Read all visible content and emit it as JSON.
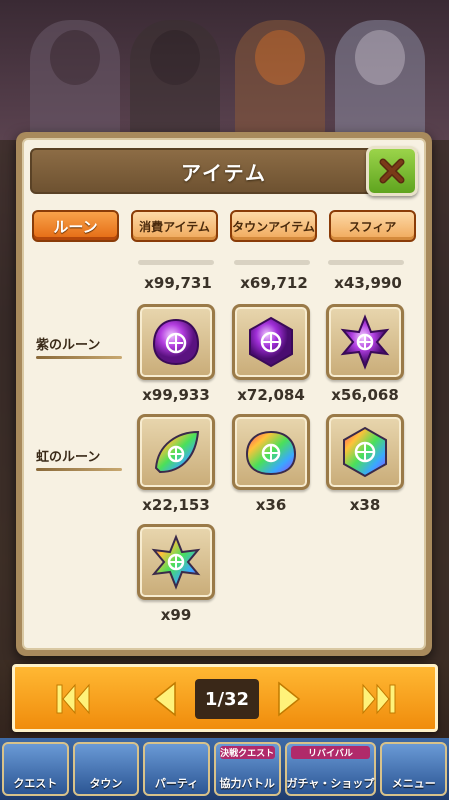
{
  "title": "アイテム",
  "tabs": [
    {
      "label": "ルーン",
      "active": true
    },
    {
      "label": "消費アイテム",
      "active": false
    },
    {
      "label": "タウンアイテム",
      "active": false
    },
    {
      "label": "スフィア",
      "active": false
    }
  ],
  "top_counts": [
    "x99,731",
    "x69,712",
    "x43,990"
  ],
  "rows": [
    {
      "label": "紫のルーン"
    },
    {
      "label": "虹のルーン"
    }
  ],
  "items": [
    {
      "icon": "purple-rune-drop-icon",
      "count": "x99,933"
    },
    {
      "icon": "purple-rune-hexagon-icon",
      "count": "x72,084"
    },
    {
      "icon": "purple-rune-star-icon",
      "count": "x56,068"
    },
    {
      "icon": "rainbow-rune-leaf-icon",
      "count": "x22,153"
    },
    {
      "icon": "rainbow-rune-drop-icon",
      "count": "x36"
    },
    {
      "icon": "rainbow-rune-hexagon-icon",
      "count": "x38"
    },
    {
      "icon": "rainbow-rune-star-icon",
      "count": "x99"
    }
  ],
  "pager": {
    "page": "1/32"
  },
  "nav": [
    {
      "label": "クエスト",
      "ribbon": ""
    },
    {
      "label": "タウン",
      "ribbon": ""
    },
    {
      "label": "パーティ",
      "ribbon": ""
    },
    {
      "label": "協力バトル",
      "ribbon": "決戦クエスト"
    },
    {
      "label": "ガチャ・ショップ",
      "ribbon": "リバイバル"
    },
    {
      "label": "メニュー",
      "ribbon": ""
    }
  ],
  "colors": {
    "accent": "#f08c0c",
    "tab_active": "#e46a12",
    "close": "#5fa41f"
  }
}
